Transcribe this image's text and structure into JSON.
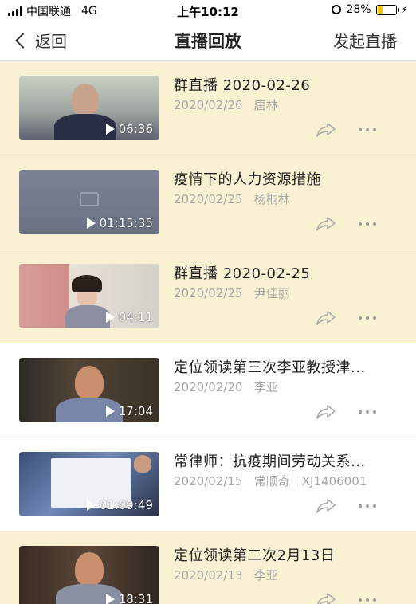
{
  "status_bar": {
    "carrier": "中国联通",
    "network": "4G",
    "time": "上午10:12",
    "battery": "28%",
    "battery_level": 0.28
  },
  "nav": {
    "back_label": "返回",
    "title": "直播回放",
    "action_label": "发起直播"
  },
  "recordings": [
    {
      "title": "群直播 2020-02-26",
      "date": "2020/02/26",
      "host": "唐林",
      "duration": "06:36",
      "highlight": true
    },
    {
      "title": "疫情下的人力资源措施",
      "date": "2020/02/25",
      "host": "杨桐林",
      "duration": "01:15:35",
      "highlight": true
    },
    {
      "title": "群直播 2020-02-25",
      "date": "2020/02/25",
      "host": "尹佳丽",
      "duration": "04:11",
      "highlight": true
    },
    {
      "title": "定位领读第三次李亚教授津...",
      "date": "2020/02/20",
      "host": "李亚",
      "duration": "17:04",
      "highlight": false
    },
    {
      "title": "常律师：抗疫期间劳动关系...",
      "date": "2020/02/15",
      "host": "常顺奇｜XJ1406001",
      "duration": "01:09:49",
      "highlight": false
    },
    {
      "title": "定位领读第二次2月13日",
      "date": "2020/02/13",
      "host": "李亚",
      "duration": "18:31",
      "highlight": true
    }
  ],
  "colors": {
    "highlight_bg": "#faf1d2",
    "meta_text": "#a5a5a5",
    "battery_fill": "#f5c400"
  }
}
